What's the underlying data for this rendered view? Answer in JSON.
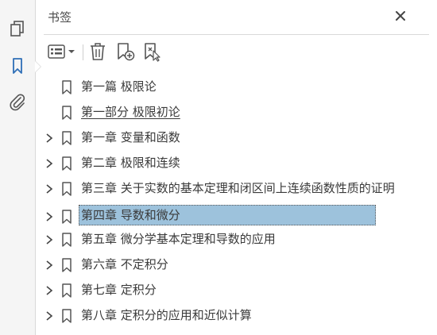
{
  "panel": {
    "title": "书签"
  },
  "rail": {
    "icons": [
      "pages-icon",
      "bookmarks-icon",
      "attachment-icon"
    ]
  },
  "toolbar": {
    "icons": [
      "options-menu-icon",
      "delete-icon",
      "new-bookmark-icon",
      "bookmark-from-selection-icon"
    ]
  },
  "bookmarks": [
    {
      "label": "第一篇  极限论",
      "expandable": false
    },
    {
      "label": "第一部分  极限初论",
      "expandable": false
    },
    {
      "label": "第一章  变量和函数",
      "expandable": true
    },
    {
      "label": "第二章  极限和连续",
      "expandable": true
    },
    {
      "label": "第三章  关于实数的基本定理和闭区间上连续函数性质的证明",
      "expandable": true
    },
    {
      "label": "第四章  导数和微分",
      "expandable": true,
      "selected": true
    },
    {
      "label": "第五章  微分学基本定理和导数的应用",
      "expandable": true
    },
    {
      "label": "第六章  不定积分",
      "expandable": true
    },
    {
      "label": "第七章  定积分",
      "expandable": true
    },
    {
      "label": "第八章  定积分的应用和近似计算",
      "expandable": true
    }
  ],
  "colors": {
    "selection": "#9dc2dc",
    "accent": "#2f6fb7"
  }
}
